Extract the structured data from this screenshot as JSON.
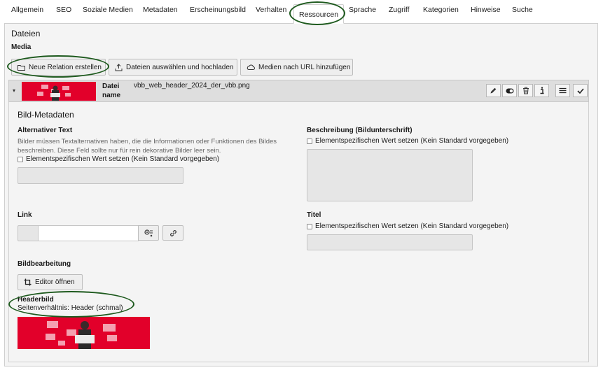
{
  "tabs": [
    {
      "label": "Allgemein",
      "active": false
    },
    {
      "label": "SEO",
      "active": false
    },
    {
      "label": "Soziale Medien",
      "active": false
    },
    {
      "label": "Metadaten",
      "active": false
    },
    {
      "label": "Erscheinungsbild",
      "active": false
    },
    {
      "label": "Verhalten",
      "active": false
    },
    {
      "label": "Ressourcen",
      "active": true
    },
    {
      "label": "Sprache",
      "active": false
    },
    {
      "label": "Zugriff",
      "active": false
    },
    {
      "label": "Kategorien",
      "active": false
    },
    {
      "label": "Hinweise",
      "active": false
    },
    {
      "label": "Suche",
      "active": false
    }
  ],
  "section": {
    "title": "Dateien",
    "subtitle": "Media"
  },
  "toolbar": {
    "new_relation": "Neue Relation erstellen",
    "upload": "Dateien auswählen und hochladen",
    "add_url": "Medien nach URL hinzufügen"
  },
  "file": {
    "label": "Datei\nname",
    "name": "vbb_web_header_2024_der_vbb.png",
    "actions": [
      "pencil-icon",
      "toggle-icon",
      "trash-icon",
      "info-icon",
      "menu-icon",
      "check-icon"
    ]
  },
  "metadata": {
    "title": "Bild-Metadaten",
    "alt": {
      "label": "Alternativer Text",
      "description": "Bilder müssen Textalternativen haben, die die Informationen oder Funktionen des Bildes beschreiben. Diese Feld sollte nur für rein dekorative Bilder leer sein.",
      "checkbox": "Elementspezifischen Wert setzen (Kein Standard vorgegeben)"
    },
    "caption": {
      "label": "Beschreibung (Bildunterschrift)",
      "checkbox": "Elementspezifischen Wert setzen (Kein Standard vorgegeben)"
    },
    "link": {
      "label": "Link",
      "value": ""
    },
    "titel": {
      "label": "Titel",
      "checkbox": "Elementspezifischen Wert setzen (Kein Standard vorgegeben)"
    },
    "edit": {
      "label": "Bildbearbeitung",
      "button": "Editor öffnen"
    },
    "header": {
      "label": "Headerbild",
      "ratio": "Seitenverhältnis: Header (schmal)"
    }
  },
  "colors": {
    "brand_red": "#e2002a",
    "annotation_green": "#1e5a1e"
  }
}
